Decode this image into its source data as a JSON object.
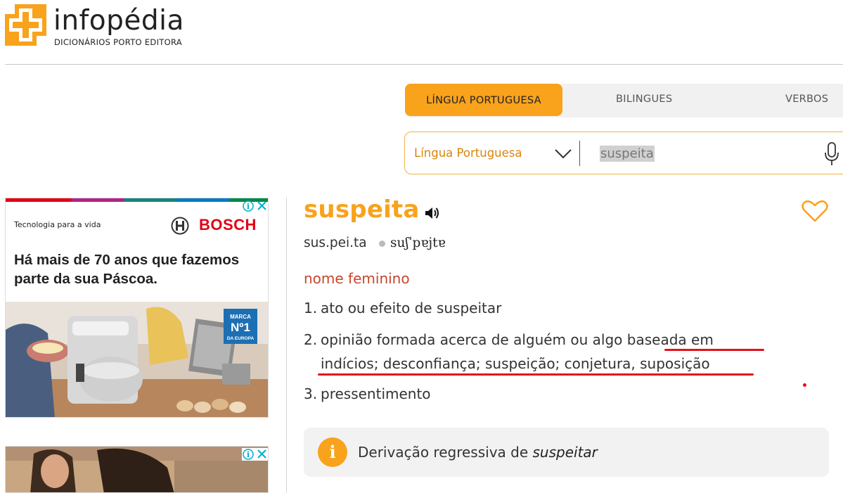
{
  "logo": {
    "name": "infopédia",
    "subtitle": "DICIONÁRIOS PORTO EDITORA"
  },
  "tabs": [
    {
      "label": "LÍNGUA PORTUGUESA",
      "active": true
    },
    {
      "label": "BILINGUES",
      "active": false
    },
    {
      "label": "VERBOS",
      "active": false
    }
  ],
  "search": {
    "dictionary": "Língua Portuguesa",
    "query": "suspeita"
  },
  "ad1": {
    "tagline": "Tecnologia para a vida",
    "brand": "BOSCH",
    "headline": "Há mais de 70 anos que fazemos parte da sua Páscoa.",
    "badge_top": "MARCA",
    "badge_main": "Nº1",
    "badge_bottom": "DA EUROPA"
  },
  "entry": {
    "headword": "suspeita",
    "syllables": "sus.pei.ta",
    "ipa": "suʃˈpɐjtɐ",
    "part_of_speech": "nome feminino",
    "definitions": [
      {
        "num": "1.",
        "text": "ato ou efeito de suspeitar"
      },
      {
        "num": "2.",
        "line1": "opinião formada acerca de alguém ou algo baseada em",
        "line2": "indícios; desconfiança; suspeição; conjetura, suposição"
      },
      {
        "num": "3.",
        "text": "pressentimento"
      }
    ],
    "note_prefix": "Derivação regressiva de",
    "note_word": "suspeitar"
  },
  "colors": {
    "accent": "#f9a21c",
    "pos": "#c8462c",
    "underline": "#e2121b"
  },
  "icons": [
    "logo-icon",
    "chevron-down-icon",
    "microphone-icon",
    "speaker-icon",
    "heart-icon",
    "info-icon",
    "ad-info-icon",
    "ad-close-icon"
  ]
}
